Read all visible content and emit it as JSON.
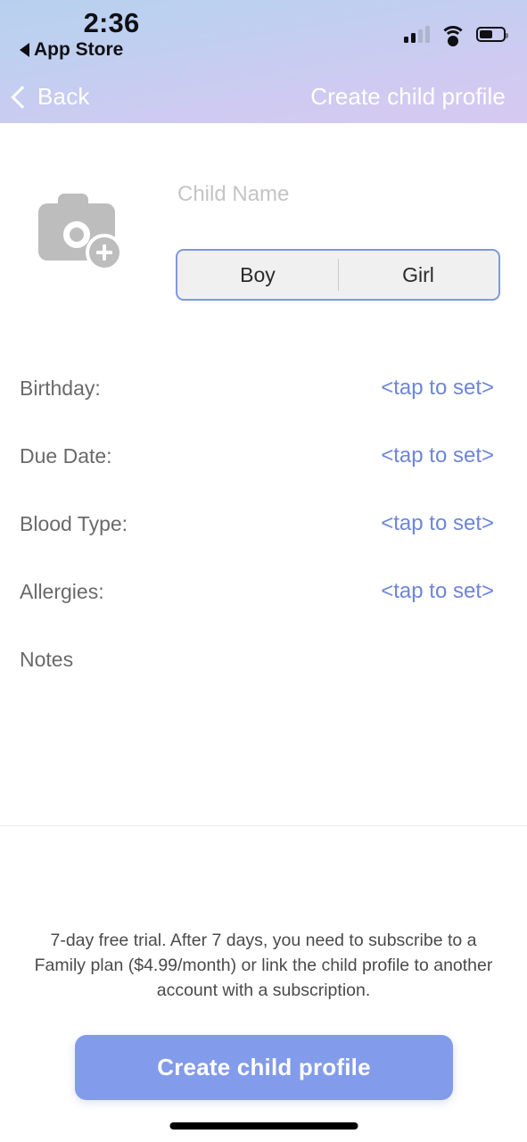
{
  "status_bar": {
    "time": "2:36",
    "return_app": "App Store",
    "signal_icon": "cellular-signal-icon",
    "wifi_icon": "wifi-icon",
    "battery_icon": "battery-icon"
  },
  "nav_bar": {
    "back_label": "Back",
    "back_icon": "chevron-left-icon",
    "title": "Create child profile"
  },
  "profile": {
    "photo_icon": "camera-add-photo-icon",
    "name_placeholder": "Child Name",
    "name_value": "",
    "gender_options": [
      {
        "label": "Boy"
      },
      {
        "label": "Girl"
      }
    ]
  },
  "fields": [
    {
      "label": "Birthday:",
      "value": "<tap to set>"
    },
    {
      "label": "Due Date:",
      "value": "<tap to set>"
    },
    {
      "label": "Blood Type:",
      "value": "<tap to set>"
    },
    {
      "label": "Allergies:",
      "value": "<tap to set>"
    }
  ],
  "notes": {
    "label": "Notes",
    "value": ""
  },
  "footer": {
    "trial_text": "7-day free trial. After 7 days, you need to subscribe to a Family plan ($4.99/month) or link the child profile to another account with a subscription.",
    "cta_label": "Create child profile"
  },
  "colors": {
    "accent_blue": "#6e85d8",
    "cta_background": "#829bea",
    "header_gradient_start": "#b8d0ef",
    "header_gradient_end": "#d6c9f1",
    "label_gray": "#6a6a6a",
    "placeholder_gray": "#c4c4c4"
  }
}
